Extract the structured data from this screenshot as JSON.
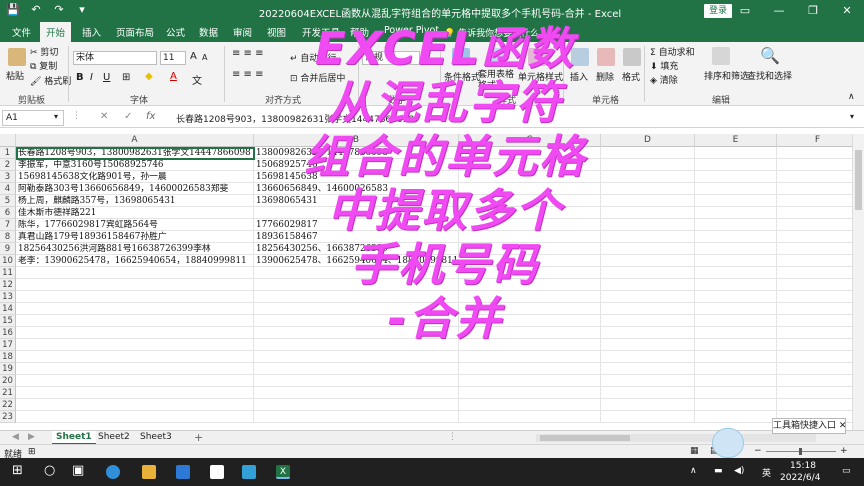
{
  "window": {
    "title": "20220604EXCEL函数从混乱字符组合的单元格中提取多个手机号码-合并  -  Excel",
    "login_label": "登录",
    "minimize": "—",
    "restore": "❐",
    "close": "✕"
  },
  "qat": {
    "save": "💾",
    "undo": "↶",
    "redo": "↷",
    "more": "▾"
  },
  "tabs": [
    "文件",
    "开始",
    "插入",
    "页面布局",
    "公式",
    "数据",
    "审阅",
    "视图",
    "开发工具",
    "帮助",
    "Power Pivot"
  ],
  "active_tab": "开始",
  "tell_me": "告诉我你想要做什么",
  "ribbon": {
    "clipboard": {
      "paste": "粘贴",
      "cut": "剪切",
      "copy": "复制",
      "format_painter": "格式刷",
      "label": "剪贴板"
    },
    "font": {
      "name": "宋体",
      "size": "11",
      "label": "字体",
      "bold": "B",
      "italic": "I",
      "underline": "U",
      "grow": "A",
      "shrink": "A",
      "color_a": "A",
      "wen": "文"
    },
    "alignment": {
      "wrap": "自动换行",
      "merge": "合并后居中",
      "label": "对齐方式"
    },
    "number": {
      "format": "常规",
      "label": "数字"
    },
    "styles": {
      "conditional": "条件格式",
      "table": "套用表格格式",
      "cell_styles": "单元格样式",
      "label": "样式"
    },
    "cells": {
      "insert": "插入",
      "delete": "删除",
      "format": "格式",
      "label": "单元格"
    },
    "editing": {
      "autosum": "自动求和",
      "fill": "填充",
      "clear": "清除",
      "sort": "排序和筛选",
      "find": "查找和选择",
      "label": "编辑"
    }
  },
  "formula_bar": {
    "name_box": "A1",
    "cancel": "✕",
    "enter": "✓",
    "fx": "fx",
    "value": "长春路1208号903，13800982631张学文14447866098"
  },
  "columns": [
    "A",
    "B",
    "C",
    "D",
    "E",
    "F"
  ],
  "rows": [
    {
      "n": "1",
      "a": "长春路1208号903，13800982631张学文14447866098",
      "b": "13800982631、14447866098"
    },
    {
      "n": "2",
      "a": "李振军，中意3160号15068925746",
      "b": "15068925746"
    },
    {
      "n": "3",
      "a": "15698145638文化路901号，孙一晨",
      "b": "15698145638"
    },
    {
      "n": "4",
      "a": "阿勒泰路303号13660656849，14600026583郑斐",
      "b": "13660656849、14600026583"
    },
    {
      "n": "5",
      "a": "杨上周，麒麟路357号，13698065431",
      "b": "13698065431"
    },
    {
      "n": "6",
      "a": "佳木斯市德祥路221",
      "b": ""
    },
    {
      "n": "7",
      "a": "陈华，17766029817宾虹路564号",
      "b": "17766029817"
    },
    {
      "n": "8",
      "a": "真君山路179号18936158467孙胜广",
      "b": "18936158467"
    },
    {
      "n": "9",
      "a": "18256430256洪河路881号16638726399李林",
      "b": "18256430256、16638726399"
    },
    {
      "n": "10",
      "a": "老李：13900625478，16625940654，18840999811",
      "b": "13900625478、16625940654、18840999811"
    },
    {
      "n": "11",
      "a": "",
      "b": ""
    },
    {
      "n": "12",
      "a": "",
      "b": ""
    },
    {
      "n": "13",
      "a": "",
      "b": ""
    },
    {
      "n": "14",
      "a": "",
      "b": ""
    },
    {
      "n": "15",
      "a": "",
      "b": ""
    },
    {
      "n": "16",
      "a": "",
      "b": ""
    },
    {
      "n": "17",
      "a": "",
      "b": ""
    },
    {
      "n": "18",
      "a": "",
      "b": ""
    },
    {
      "n": "19",
      "a": "",
      "b": ""
    },
    {
      "n": "20",
      "a": "",
      "b": ""
    },
    {
      "n": "21",
      "a": "",
      "b": ""
    },
    {
      "n": "22",
      "a": "",
      "b": ""
    },
    {
      "n": "23",
      "a": "",
      "b": ""
    }
  ],
  "overlay": {
    "lines": [
      "EXCEL函数",
      "从混乱字符",
      "组合的单元格",
      "中提取多个",
      "手机号码",
      "-合并"
    ],
    "color": "#f04bf2"
  },
  "sheets": [
    "Sheet1",
    "Sheet2",
    "Sheet3"
  ],
  "active_sheet": "Sheet1",
  "add_sheet": "+",
  "status": {
    "ready": "就绪",
    "zoom_minus": "−",
    "zoom_plus": "+"
  },
  "toolbox": "工具箱快捷入口",
  "taskbar": {
    "time": "15:18",
    "date": "2022/6/4",
    "lang": "英"
  },
  "colors": {
    "excel_green": "#217346",
    "taskbar": "#202020"
  }
}
